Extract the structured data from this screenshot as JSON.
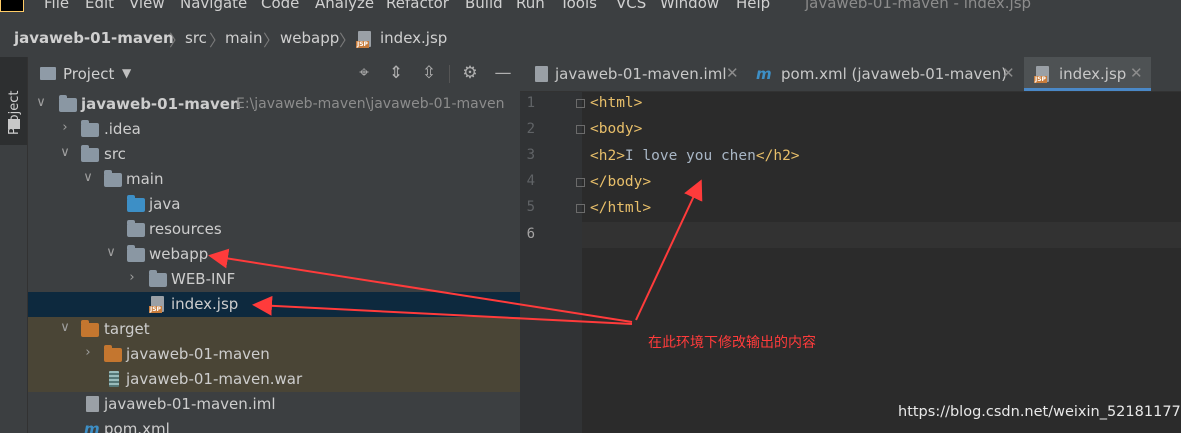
{
  "menu": {
    "items": [
      "File",
      "Edit",
      "View",
      "Navigate",
      "Code",
      "Analyze",
      "Refactor",
      "Build",
      "Run",
      "Tools",
      "VCS",
      "Window",
      "Help"
    ],
    "window_title": "javaweb-01-maven - index.jsp"
  },
  "breadcrumb": [
    "javaweb-01-maven",
    "src",
    "main",
    "webapp",
    "index.jsp"
  ],
  "tool_window": {
    "stripe_label": "Project",
    "title": "Project",
    "icons": [
      "locate-icon",
      "expand-all-icon",
      "collapse-all-icon",
      "gear-icon",
      "minimize-icon"
    ]
  },
  "tree": [
    {
      "label": "javaweb-01-maven",
      "path": "E:\\javaweb-maven\\javaweb-01-maven"
    },
    {
      "label": ".idea"
    },
    {
      "label": "src"
    },
    {
      "label": "main"
    },
    {
      "label": "java"
    },
    {
      "label": "resources"
    },
    {
      "label": "webapp"
    },
    {
      "label": "WEB-INF"
    },
    {
      "label": "index.jsp"
    },
    {
      "label": "target"
    },
    {
      "label": "javaweb-01-maven"
    },
    {
      "label": "javaweb-01-maven.war"
    },
    {
      "label": "javaweb-01-maven.iml"
    },
    {
      "label": "pom.xml"
    }
  ],
  "tabs": [
    {
      "label": "javaweb-01-maven.iml"
    },
    {
      "label": "pom.xml (javaweb-01-maven)"
    },
    {
      "label": "index.jsp",
      "active": true
    }
  ],
  "editor": {
    "line_numbers": [
      "1",
      "2",
      "3",
      "4",
      "5",
      "6"
    ],
    "lines": [
      {
        "open": "<html>"
      },
      {
        "open": "<body>"
      },
      {
        "open": "<h2>",
        "text": "I love you chen",
        "close": "</h2>"
      },
      {
        "open": "</body>"
      },
      {
        "open": "</html>"
      },
      {
        "open": ""
      }
    ]
  },
  "annotation": "在此环境下修改输出的内容",
  "watermark": "https://blog.csdn.net/weixin_52181177",
  "colors": {
    "tag": "#e8bf6a",
    "text": "#a9b7c6",
    "selection": "#0d293e",
    "excluded": "#4a4536",
    "arrow": "#ff3b3b"
  }
}
